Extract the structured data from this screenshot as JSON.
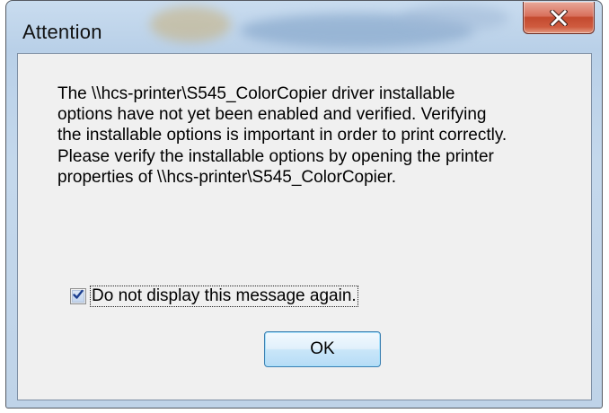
{
  "window": {
    "title": "Attention",
    "close_icon": "close-icon"
  },
  "message": {
    "lines": [
      "The \\\\hcs-printer\\S545_ColorCopier driver installable",
      "options have not yet been enabled and verified. Verifying",
      "the installable options is important in order to print correctly.",
      "Please verify the installable options by opening the printer",
      "properties of \\\\hcs-printer\\S545_ColorCopier."
    ]
  },
  "checkbox": {
    "label": "Do not display this message again.",
    "checked": true
  },
  "buttons": {
    "ok_label": "OK"
  },
  "colors": {
    "close_button": "#c44a2f",
    "ok_border": "#3c7fb1",
    "client_bg": "#f0f0f0"
  }
}
